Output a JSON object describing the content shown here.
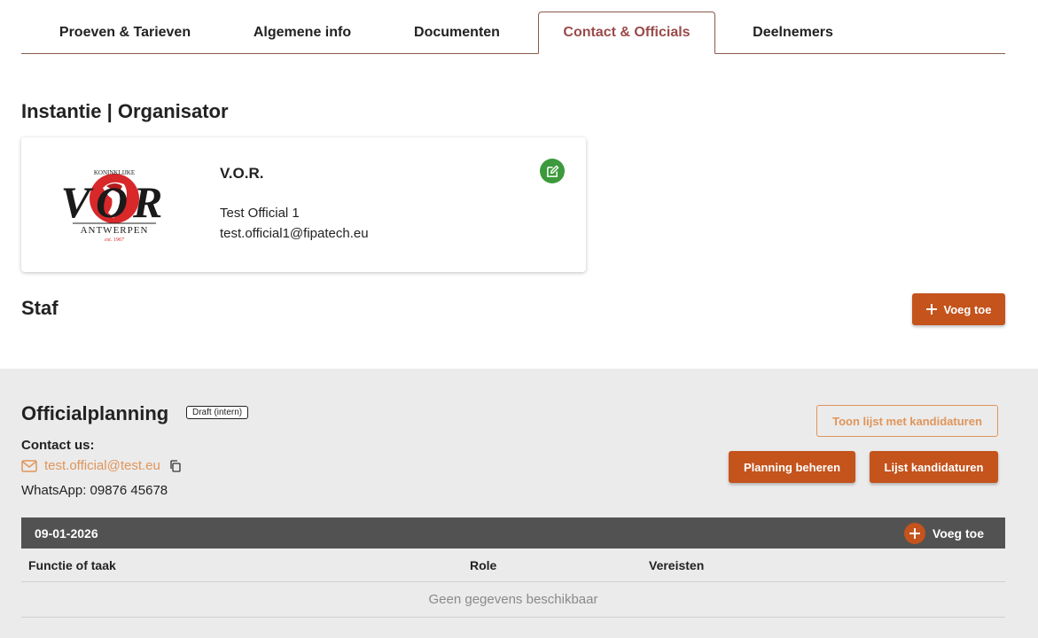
{
  "tabs": [
    {
      "label": "Proeven & Tarieven",
      "active": false
    },
    {
      "label": "Algemene info",
      "active": false
    },
    {
      "label": "Documenten",
      "active": false
    },
    {
      "label": "Contact & Officials",
      "active": true
    },
    {
      "label": "Deelnemers",
      "active": false
    }
  ],
  "organizer": {
    "section_title": "Instantie | Organisator",
    "logo": {
      "top_text": "KONINKLIJKE",
      "main_text": "VOR",
      "bottom_text": "ANTWERPEN",
      "est_text": "est. 1967"
    },
    "name": "V.O.R.",
    "official_name": "Test Official 1",
    "official_email": "test.official1@fipatech.eu",
    "edit_icon": "edit-icon"
  },
  "staff": {
    "section_title": "Staf",
    "add_label": "Voeg toe"
  },
  "planning": {
    "title": "Officialplanning",
    "badge": "Draft (intern)",
    "contact_label": "Contact us:",
    "contact_email": "test.official@test.eu",
    "whatsapp": "WhatsApp: 09876 45678",
    "show_candidates_label": "Toon lijst met kandidaturen",
    "manage_planning_label": "Planning beheren",
    "candidates_list_label": "Lijst kandidaturen",
    "date": "09-01-2026",
    "date_add_label": "Voeg toe",
    "columns": [
      "Functie of taak",
      "Role",
      "Vereisten"
    ],
    "empty_text": "Geen gegevens beschikbaar"
  },
  "colors": {
    "accent": "#c4531c",
    "accent_light": "#e0955a",
    "tab_active": "#9a4a4a",
    "edit_green": "#3c9a3c",
    "date_bar": "#525252",
    "logo_red": "#d8282a"
  }
}
